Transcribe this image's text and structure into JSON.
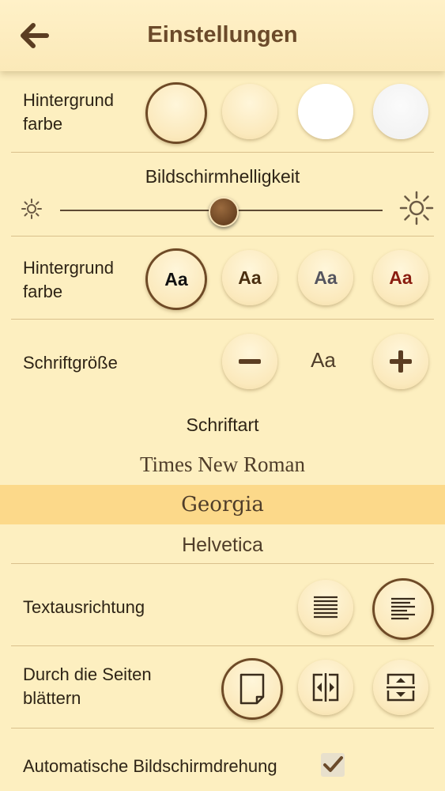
{
  "header": {
    "title": "Einstellungen",
    "back_icon": "arrow-left-icon"
  },
  "background_color": {
    "label": "Hintergrund farbe",
    "options": [
      "cream",
      "light-cream",
      "white",
      "grain"
    ],
    "selected": 0
  },
  "brightness": {
    "title": "Bildschirmhelligkeit",
    "value": 0.5
  },
  "text_color": {
    "label": "Hintergrund farbe",
    "sample": "Aa",
    "colors": [
      "#111111",
      "#4a2f10",
      "#55555f",
      "#8a1d10"
    ],
    "selected": 0
  },
  "font_size": {
    "label": "Schriftgröße",
    "sample": "Aa"
  },
  "font_family": {
    "title": "Schriftart",
    "options": [
      "Times New Roman",
      "Georgia",
      "Helvetica"
    ],
    "selected": "Georgia"
  },
  "text_alignment": {
    "label": "Textausrichtung",
    "selected": "left"
  },
  "page_turn": {
    "label": "Durch die Seiten blättern",
    "selected": "curl"
  },
  "auto_rotation": {
    "label": "Automatische Bildschirmdrehung",
    "checked": true
  },
  "colors": {
    "accent": "#6b4a2a",
    "background": "#fdefc0",
    "highlight": "#fcd98a"
  }
}
